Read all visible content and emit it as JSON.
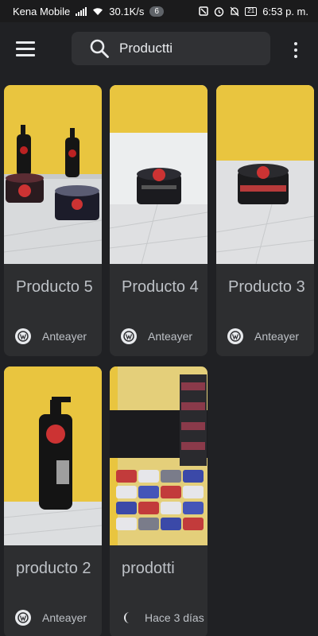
{
  "status_bar": {
    "carrier": "Kena Mobile",
    "speed": "30.1K/s",
    "badge": "6",
    "battery": "21",
    "time": "6:53 p. m."
  },
  "search": {
    "query": "Productti"
  },
  "icons": {
    "menu": "hamburger-menu-icon",
    "search": "search-icon",
    "more": "more-vertical-icon",
    "site": "wordpress-icon"
  },
  "colors": {
    "background": "#202124",
    "card": "#2d2e30",
    "wall_yellow": "#e9c53f"
  },
  "cards": [
    {
      "title": "Producto 5",
      "meta": "Anteayer"
    },
    {
      "title": "Producto 4",
      "meta": "Anteayer"
    },
    {
      "title": "Producto 3",
      "meta": "Anteayer"
    },
    {
      "title": "producto 2",
      "meta": "Anteayer"
    },
    {
      "title": "prodotti",
      "meta": "Hace 3 días"
    }
  ]
}
